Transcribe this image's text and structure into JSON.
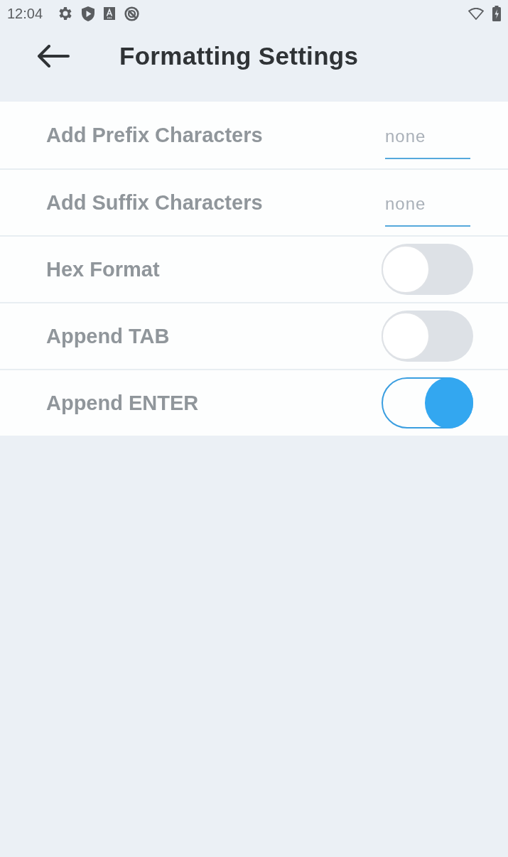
{
  "status_bar": {
    "time": "12:04"
  },
  "app_bar": {
    "title": "Formatting Settings"
  },
  "settings": [
    {
      "kind": "text",
      "label": "Add Prefix Characters",
      "placeholder": "none"
    },
    {
      "kind": "text",
      "label": "Add Suffix Characters",
      "placeholder": "none"
    },
    {
      "kind": "switch",
      "label": "Hex Format",
      "on": false
    },
    {
      "kind": "switch",
      "label": "Append TAB",
      "on": false
    },
    {
      "kind": "switch",
      "label": "Append ENTER",
      "on": true
    }
  ]
}
